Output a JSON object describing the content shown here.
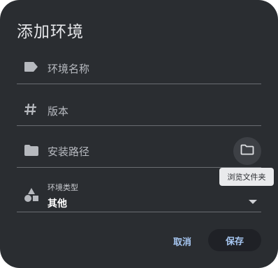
{
  "dialog": {
    "title": "添加环境",
    "fields": {
      "name": {
        "placeholder": "环境名称",
        "icon": "label-icon"
      },
      "version": {
        "placeholder": "版本",
        "icon": "hash-icon"
      },
      "path": {
        "placeholder": "安装路径",
        "icon": "folder-icon",
        "browse_tooltip": "浏览文件夹"
      },
      "type": {
        "label": "环境类型",
        "value": "其他",
        "icon": "shapes-icon"
      }
    },
    "actions": {
      "cancel": "取消",
      "save": "保存"
    }
  },
  "colors": {
    "background": "#2a2d31",
    "accent": "#a7c7f2",
    "text": "#e6e7ea"
  }
}
